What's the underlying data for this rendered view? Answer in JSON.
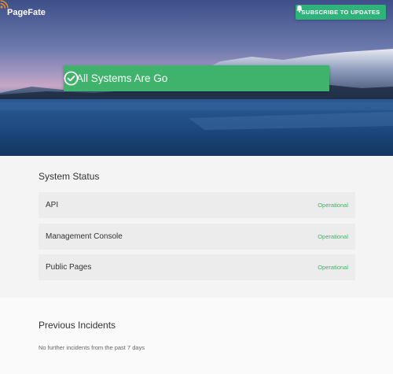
{
  "header": {
    "brand": "PageFate",
    "subscribe_label": "SUBSCRIBE TO UPDATES",
    "rss_icon": "rss-icon",
    "bell_icon": "bell-icon"
  },
  "banner": {
    "text": "All Systems Are Go",
    "icon": "check-circle-icon",
    "color": "#3fb26b"
  },
  "status": {
    "title": "System Status",
    "components": [
      {
        "name": "API",
        "state": "Operational"
      },
      {
        "name": "Management Console",
        "state": "Operational"
      },
      {
        "name": "Public Pages",
        "state": "Operational"
      }
    ]
  },
  "incidents": {
    "title": "Previous Incidents",
    "note": "No further incidents from the past 7 days"
  },
  "colors": {
    "accent": "#2fb37a",
    "operational": "#3fb26b"
  }
}
